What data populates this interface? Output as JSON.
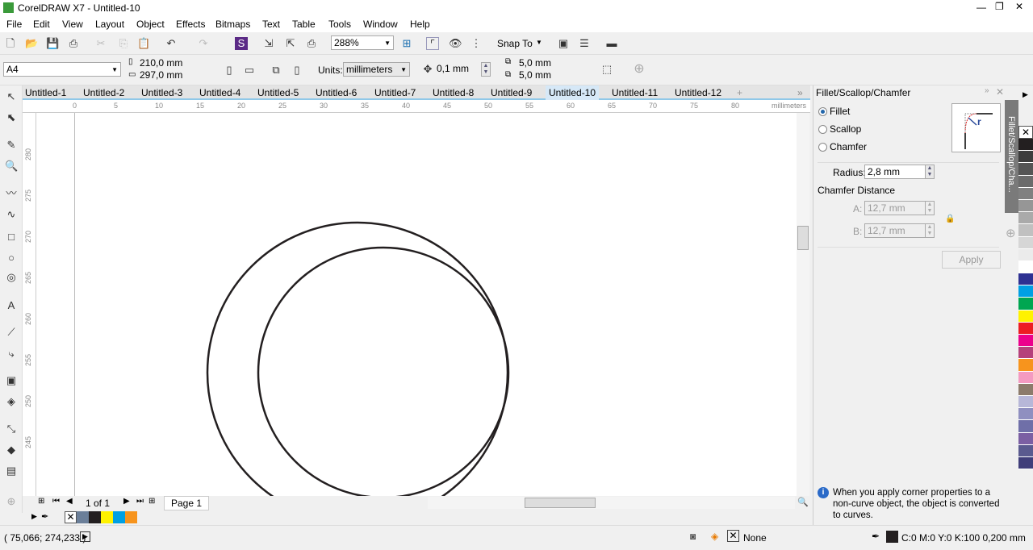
{
  "window": {
    "title": "CorelDRAW X7 - Untitled-10"
  },
  "menu": [
    "File",
    "Edit",
    "View",
    "Layout",
    "Object",
    "Effects",
    "Bitmaps",
    "Text",
    "Table",
    "Tools",
    "Window",
    "Help"
  ],
  "toolbar": {
    "zoom": "288%",
    "snap_to": "Snap To"
  },
  "property_bar": {
    "page_size": "A4",
    "width": "210,0 mm",
    "height": "297,0 mm",
    "units_label": "Units:",
    "units": "millimeters",
    "nudge": "0,1 mm",
    "dup_x": "5,0 mm",
    "dup_y": "5,0 mm"
  },
  "tabs": [
    "Untitled-1",
    "Untitled-2",
    "Untitled-3",
    "Untitled-4",
    "Untitled-5",
    "Untitled-6",
    "Untitled-7",
    "Untitled-8",
    "Untitled-9",
    "Untitled-10",
    "Untitled-11",
    "Untitled-12"
  ],
  "active_tab": "Untitled-10",
  "ruler": {
    "unit": "millimeters",
    "top_ticks": [
      "0",
      "5",
      "10",
      "15",
      "20",
      "25",
      "30",
      "35",
      "40",
      "45",
      "50",
      "55",
      "60",
      "65",
      "70",
      "75",
      "80"
    ],
    "left_ticks": [
      "280",
      "275",
      "270",
      "265",
      "260",
      "255",
      "250",
      "245"
    ]
  },
  "page_nav": {
    "count": "1 of 1",
    "page_tab": "Page 1"
  },
  "docker": {
    "title": "Fillet/Scallop/Chamfer",
    "side_tab": "Fillet/Scallop/Cha...",
    "options": [
      "Fillet",
      "Scallop",
      "Chamfer"
    ],
    "selected": "Fillet",
    "radius_label": "Radius:",
    "radius": "2,8 mm",
    "chamfer_label": "Chamfer Distance",
    "a_label": "A:",
    "a_value": "12,7 mm",
    "b_label": "B:",
    "b_value": "12,7 mm",
    "apply": "Apply",
    "info": "When you apply corner properties to a non-curve object, the object is converted to curves."
  },
  "status": {
    "coords": "( 75,066; 274,233 )",
    "fill": "None",
    "outline": "C:0 M:0 Y:0 K:100  0,200 mm"
  },
  "doc_palette": [
    "#6b7f99",
    "#231f20",
    "#fff200",
    "#00a0e3",
    "#f7941d"
  ],
  "palette": [
    "#231f20",
    "#3d3d3d",
    "#555555",
    "#6b6b6b",
    "#808080",
    "#969696",
    "#aaaaaa",
    "#c0c0c0",
    "#d6d6d6",
    "#ebebeb",
    "#ffffff",
    "#2e3192",
    "#00a0e3",
    "#00a651",
    "#fff200",
    "#ed1c24",
    "#ec008c",
    "#b5417b",
    "#f7941d",
    "#f49ac1",
    "#8c7b6b",
    "#b7b7d8",
    "#8f8fc0",
    "#6f6fa8",
    "#7b5fa3",
    "#5a5a8f",
    "#403e7a"
  ]
}
